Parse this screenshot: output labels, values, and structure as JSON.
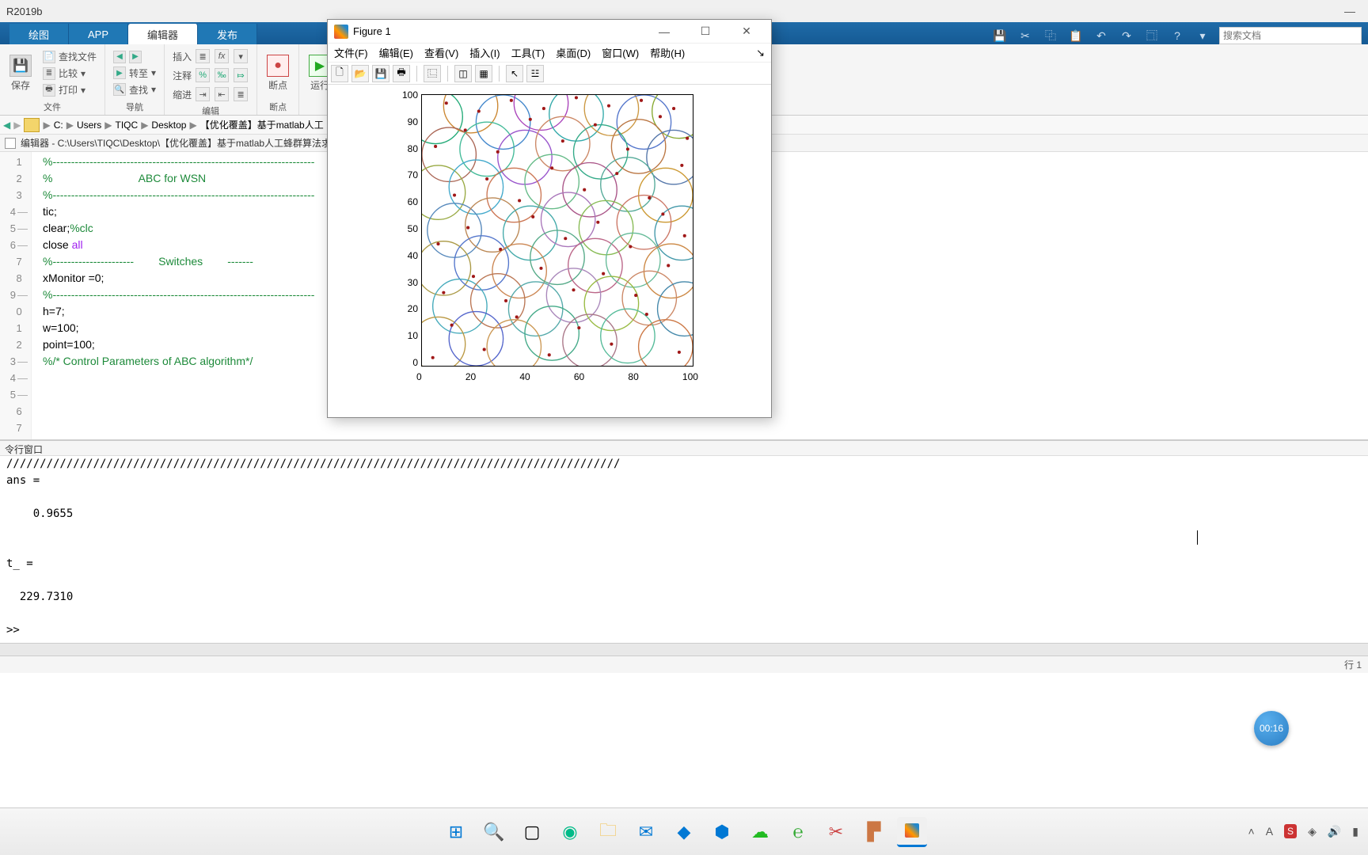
{
  "app": {
    "title": "R2019b",
    "search_placeholder": "搜索文档"
  },
  "tabs": [
    "绘图",
    "APP",
    "编辑器",
    "发布"
  ],
  "active_tab_index": 2,
  "ribbon": {
    "file": {
      "save": "保存",
      "find_files": "查找文件",
      "compare": "比较",
      "print": "打印",
      "label": "文件"
    },
    "nav": {
      "goto": "转至",
      "find": "查找",
      "label": "导航"
    },
    "edit": {
      "insert": "插入",
      "comment": "注释",
      "indent": "缩进",
      "label": "编辑"
    },
    "breakpoints": {
      "breakpoints": "断点",
      "label": "断点"
    },
    "run": {
      "run": "运行"
    }
  },
  "breadcrumb": [
    "C:",
    "Users",
    "TIQC",
    "Desktop",
    "【优化覆盖】基于matlab人工"
  ],
  "editor": {
    "title": "编辑器 - C:\\Users\\TIQC\\Desktop\\【优化覆盖】基于matlab人工蜂群算法求",
    "lines": [
      {
        "n": 1,
        "t": "%-----------------------------------------------------------------------",
        "cls": "cm-comment"
      },
      {
        "n": 2,
        "t": "%                            ABC for WSN",
        "cls": "cm-comment"
      },
      {
        "n": 3,
        "t": "%-----------------------------------------------------------------------",
        "cls": "cm-comment"
      },
      {
        "n": 4,
        "d": true,
        "t": "tic;"
      },
      {
        "n": 5,
        "d": true,
        "html": "clear;<span class='cm-comment'>%clc</span>"
      },
      {
        "n": 6,
        "d": true,
        "html": "close <span class='cm-string'>all</span>"
      },
      {
        "n": 7,
        "t": ""
      },
      {
        "n": 8,
        "t": "%----------------------        Switches        -------",
        "cls": "cm-comment"
      },
      {
        "n": 9,
        "d": true,
        "t": "xMonitor =0;"
      },
      {
        "n": 0,
        "t": "%-----------------------------------------------------------------------",
        "cls": "cm-comment"
      },
      {
        "n": 1,
        "t": ""
      },
      {
        "n": 2,
        "t": ""
      },
      {
        "n": 3,
        "d": true,
        "t": "h=7;"
      },
      {
        "n": 4,
        "d": true,
        "t": "w=100;"
      },
      {
        "n": 5,
        "d": true,
        "t": "point=100;"
      },
      {
        "n": 6,
        "t": ""
      },
      {
        "n": 7,
        "t": "%/* Control Parameters of ABC algorithm*/",
        "cls": "cm-comment"
      }
    ]
  },
  "cmd": {
    "title": "令行窗口",
    "output": "////////////////////////////////////////////////////////////////////////////////////////////\nans =\n\n    0.9655\n\n\nt_ =\n\n  229.7310\n\n>> "
  },
  "status": {
    "line_col": "行 1"
  },
  "figure": {
    "title": "Figure 1",
    "menus": [
      "文件(F)",
      "编辑(E)",
      "查看(V)",
      "插入(I)",
      "工具(T)",
      "桌面(D)",
      "窗口(W)",
      "帮助(H)"
    ]
  },
  "chart_data": {
    "type": "scatter",
    "xlim": [
      0,
      100
    ],
    "ylim": [
      0,
      100
    ],
    "xticks": [
      0,
      20,
      40,
      60,
      80,
      100
    ],
    "yticks": [
      0,
      10,
      20,
      30,
      40,
      50,
      60,
      70,
      80,
      90,
      100
    ],
    "circle_radius": 10,
    "circles": [
      {
        "x": 5,
        "y": 92,
        "c": "#2a7"
      },
      {
        "x": 18,
        "y": 96,
        "c": "#c83"
      },
      {
        "x": 30,
        "y": 90,
        "c": "#48c"
      },
      {
        "x": 44,
        "y": 97,
        "c": "#a4b"
      },
      {
        "x": 57,
        "y": 93,
        "c": "#3aa"
      },
      {
        "x": 70,
        "y": 95,
        "c": "#c94"
      },
      {
        "x": 82,
        "y": 90,
        "c": "#57c"
      },
      {
        "x": 95,
        "y": 94,
        "c": "#8a3"
      },
      {
        "x": 10,
        "y": 78,
        "c": "#a65"
      },
      {
        "x": 24,
        "y": 80,
        "c": "#4b9"
      },
      {
        "x": 38,
        "y": 77,
        "c": "#95c"
      },
      {
        "x": 52,
        "y": 82,
        "c": "#c86"
      },
      {
        "x": 66,
        "y": 79,
        "c": "#3a8"
      },
      {
        "x": 80,
        "y": 81,
        "c": "#b74"
      },
      {
        "x": 93,
        "y": 77,
        "c": "#57a"
      },
      {
        "x": 6,
        "y": 64,
        "c": "#9a4"
      },
      {
        "x": 20,
        "y": 66,
        "c": "#4ac"
      },
      {
        "x": 34,
        "y": 63,
        "c": "#c75"
      },
      {
        "x": 48,
        "y": 68,
        "c": "#6b8"
      },
      {
        "x": 62,
        "y": 65,
        "c": "#a58"
      },
      {
        "x": 76,
        "y": 67,
        "c": "#5a9"
      },
      {
        "x": 90,
        "y": 63,
        "c": "#c93"
      },
      {
        "x": 12,
        "y": 50,
        "c": "#58b"
      },
      {
        "x": 26,
        "y": 52,
        "c": "#b85"
      },
      {
        "x": 40,
        "y": 49,
        "c": "#4aa"
      },
      {
        "x": 54,
        "y": 54,
        "c": "#a7b"
      },
      {
        "x": 68,
        "y": 51,
        "c": "#8b5"
      },
      {
        "x": 82,
        "y": 53,
        "c": "#c76"
      },
      {
        "x": 96,
        "y": 49,
        "c": "#49a"
      },
      {
        "x": 8,
        "y": 36,
        "c": "#a94"
      },
      {
        "x": 22,
        "y": 38,
        "c": "#57c"
      },
      {
        "x": 36,
        "y": 35,
        "c": "#c85"
      },
      {
        "x": 50,
        "y": 40,
        "c": "#5a8"
      },
      {
        "x": 64,
        "y": 37,
        "c": "#b68"
      },
      {
        "x": 78,
        "y": 39,
        "c": "#6b9"
      },
      {
        "x": 92,
        "y": 35,
        "c": "#c84"
      },
      {
        "x": 14,
        "y": 22,
        "c": "#4ab"
      },
      {
        "x": 28,
        "y": 24,
        "c": "#b75"
      },
      {
        "x": 42,
        "y": 21,
        "c": "#5aa"
      },
      {
        "x": 56,
        "y": 26,
        "c": "#a8b"
      },
      {
        "x": 70,
        "y": 23,
        "c": "#9b4"
      },
      {
        "x": 84,
        "y": 25,
        "c": "#c86"
      },
      {
        "x": 97,
        "y": 21,
        "c": "#48a"
      },
      {
        "x": 6,
        "y": 8,
        "c": "#b94"
      },
      {
        "x": 20,
        "y": 10,
        "c": "#56c"
      },
      {
        "x": 34,
        "y": 7,
        "c": "#c95"
      },
      {
        "x": 48,
        "y": 12,
        "c": "#4a8"
      },
      {
        "x": 62,
        "y": 9,
        "c": "#a78"
      },
      {
        "x": 76,
        "y": 11,
        "c": "#5b9"
      },
      {
        "x": 90,
        "y": 7,
        "c": "#c74"
      }
    ],
    "points": [
      {
        "x": 4,
        "y": 3
      },
      {
        "x": 11,
        "y": 15
      },
      {
        "x": 23,
        "y": 6
      },
      {
        "x": 35,
        "y": 18
      },
      {
        "x": 47,
        "y": 4
      },
      {
        "x": 58,
        "y": 14
      },
      {
        "x": 70,
        "y": 8
      },
      {
        "x": 83,
        "y": 19
      },
      {
        "x": 95,
        "y": 5
      },
      {
        "x": 8,
        "y": 27
      },
      {
        "x": 19,
        "y": 33
      },
      {
        "x": 31,
        "y": 24
      },
      {
        "x": 44,
        "y": 36
      },
      {
        "x": 56,
        "y": 28
      },
      {
        "x": 67,
        "y": 34
      },
      {
        "x": 79,
        "y": 26
      },
      {
        "x": 91,
        "y": 37
      },
      {
        "x": 6,
        "y": 45
      },
      {
        "x": 17,
        "y": 51
      },
      {
        "x": 29,
        "y": 43
      },
      {
        "x": 41,
        "y": 55
      },
      {
        "x": 53,
        "y": 47
      },
      {
        "x": 65,
        "y": 53
      },
      {
        "x": 77,
        "y": 44
      },
      {
        "x": 89,
        "y": 56
      },
      {
        "x": 97,
        "y": 48
      },
      {
        "x": 12,
        "y": 63
      },
      {
        "x": 24,
        "y": 69
      },
      {
        "x": 36,
        "y": 61
      },
      {
        "x": 48,
        "y": 73
      },
      {
        "x": 60,
        "y": 65
      },
      {
        "x": 72,
        "y": 71
      },
      {
        "x": 84,
        "y": 62
      },
      {
        "x": 96,
        "y": 74
      },
      {
        "x": 5,
        "y": 81
      },
      {
        "x": 16,
        "y": 87
      },
      {
        "x": 28,
        "y": 79
      },
      {
        "x": 40,
        "y": 91
      },
      {
        "x": 52,
        "y": 83
      },
      {
        "x": 64,
        "y": 89
      },
      {
        "x": 76,
        "y": 80
      },
      {
        "x": 88,
        "y": 92
      },
      {
        "x": 98,
        "y": 84
      },
      {
        "x": 9,
        "y": 97
      },
      {
        "x": 21,
        "y": 94
      },
      {
        "x": 33,
        "y": 98
      },
      {
        "x": 45,
        "y": 95
      },
      {
        "x": 57,
        "y": 99
      },
      {
        "x": 69,
        "y": 96
      },
      {
        "x": 81,
        "y": 98
      },
      {
        "x": 93,
        "y": 95
      }
    ]
  },
  "timer": "00:16"
}
